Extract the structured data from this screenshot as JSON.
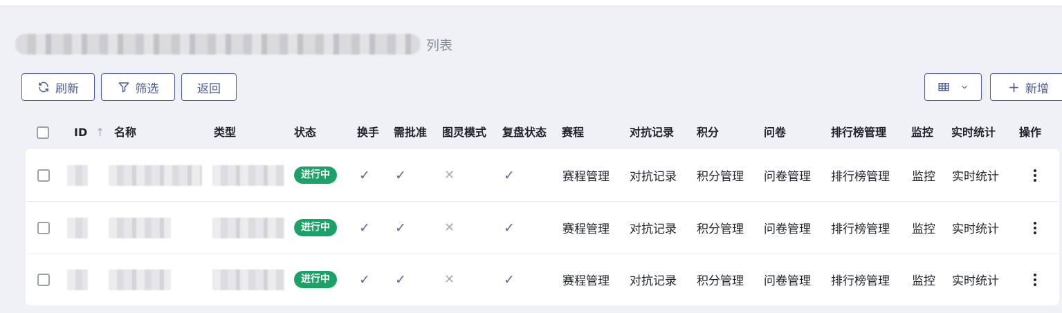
{
  "page": {
    "title_suffix": "列表"
  },
  "toolbar": {
    "refresh_label": "刷新",
    "filter_label": "筛选",
    "back_label": "返回",
    "add_label": "新增"
  },
  "colors": {
    "accent": "#4e5d9c",
    "status_green": "#1ca268",
    "check": "#5866a3",
    "cross": "#a6abb5"
  },
  "table": {
    "headers": {
      "id": "ID",
      "name": "名称",
      "type": "类型",
      "status": "状态",
      "swap": "换手",
      "approval": "需批准",
      "turing": "图灵模式",
      "review": "复盘状态",
      "schedule": "赛程",
      "battle": "对抗记录",
      "score": "积分",
      "survey": "问卷",
      "ranking": "排行榜管理",
      "monitor": "监控",
      "stats": "实时统计",
      "actions": "操作"
    },
    "rows": [
      {
        "status": "进行中",
        "swap": "check",
        "approval": "check",
        "turing": "cross",
        "review": "check",
        "schedule": "赛程管理",
        "battle": "对抗记录",
        "score": "积分管理",
        "survey": "问卷管理",
        "ranking": "排行榜管理",
        "monitor": "监控",
        "stats": "实时统计"
      },
      {
        "status": "进行中",
        "swap": "check",
        "approval": "check",
        "turing": "cross",
        "review": "check",
        "schedule": "赛程管理",
        "battle": "对抗记录",
        "score": "积分管理",
        "survey": "问卷管理",
        "ranking": "排行榜管理",
        "monitor": "监控",
        "stats": "实时统计"
      },
      {
        "status": "进行中",
        "swap": "check",
        "approval": "check",
        "turing": "cross",
        "review": "check",
        "schedule": "赛程管理",
        "battle": "对抗记录",
        "score": "积分管理",
        "survey": "问卷管理",
        "ranking": "排行榜管理",
        "monitor": "监控",
        "stats": "实时统计"
      }
    ]
  }
}
